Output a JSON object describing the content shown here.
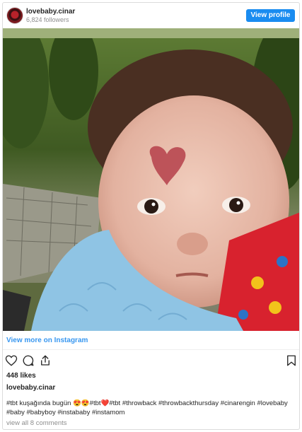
{
  "header": {
    "username": "lovebaby.cinar",
    "followers": "6,824 followers",
    "view_profile_label": "View profile"
  },
  "post": {
    "view_more_label": "View more on Instagram",
    "likes": "448 likes",
    "caption_user": "lovebaby.cinar",
    "caption_text": "#tbt kuşağında bugün 😍😍#tbt❤️#tbt #throwback #throwbackthursday #cinarengin #lovebaby #baby #babyboy #instababy #instamom",
    "comments_label": "view all 8 comments"
  },
  "icons": {
    "like": "heart-icon",
    "comment": "comment-icon",
    "share": "share-icon",
    "save": "bookmark-icon"
  },
  "colors": {
    "accent": "#1a8cf0",
    "link": "#3897f0",
    "hashtag": "#003569"
  }
}
